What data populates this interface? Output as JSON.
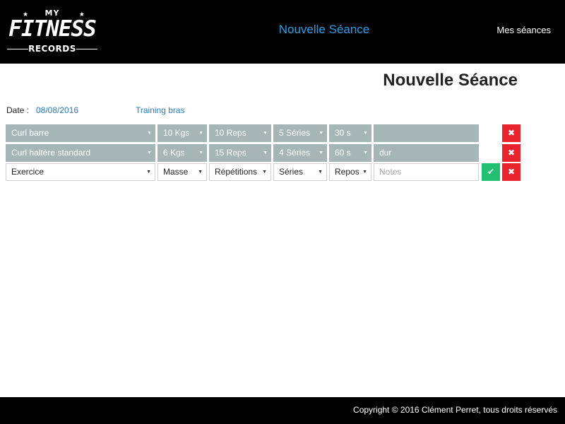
{
  "logo": {
    "my": "MY",
    "fitness": "FITNESS",
    "records": "RECORDS"
  },
  "nav": {
    "center": "Nouvelle Séance",
    "right": "Mes séances"
  },
  "page_title": "Nouvelle Séance",
  "meta": {
    "date_label": "Date :",
    "date_value": "08/08/2016",
    "session_name": "Training bras"
  },
  "rows": [
    {
      "exercise": "Curl barre",
      "mass": "10 Kgs",
      "reps": "10 Reps",
      "series": "5 Séries",
      "rest": "30 s",
      "notes": ""
    },
    {
      "exercise": "Curl haltère standard",
      "mass": "6 Kgs",
      "reps": "15 Reps",
      "series": "4 Séries",
      "rest": "60 s",
      "notes": "dur"
    }
  ],
  "new_row": {
    "exercise": "Exercice",
    "mass": "Masse",
    "reps": "Répétitions",
    "series": "Séries",
    "rest": "Repos",
    "notes_placeholder": "Notes"
  },
  "icons": {
    "confirm": "✔",
    "delete": "✖",
    "caret": "▼"
  },
  "colors": {
    "accent": "#2a9fe6",
    "filled_row": "#a6b5b5",
    "delete": "#e8232e",
    "confirm": "#22c070"
  },
  "footer": {
    "copyright": "Copyright © 2016 Clément Perret, tous droits réservés"
  }
}
